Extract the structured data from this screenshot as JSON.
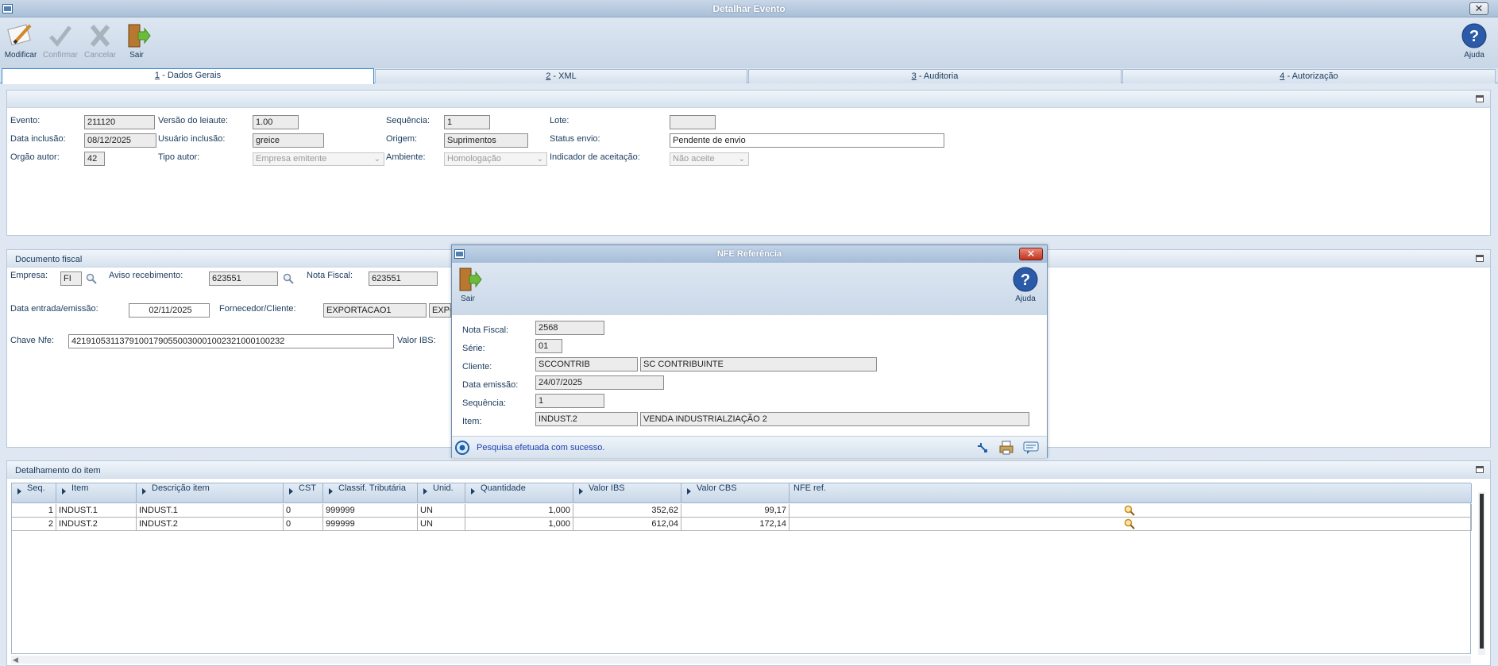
{
  "window": {
    "title": "Detalhar Evento",
    "close": "✕"
  },
  "toolbar": {
    "modificar": "Modificar",
    "confirmar": "Confirmar",
    "cancelar": "Cancelar",
    "sair": "Sair",
    "ajuda": "Ajuda"
  },
  "tabs": [
    {
      "key": "1",
      "label": " - Dados Gerais"
    },
    {
      "key": "2",
      "label": " - XML"
    },
    {
      "key": "3",
      "label": " - Auditoria"
    },
    {
      "key": "4",
      "label": " - Autorização"
    }
  ],
  "general": {
    "evento_label": "Evento:",
    "evento": "211120",
    "versao_label": "Versão do leiaute:",
    "versao": "1.00",
    "sequencia_label": "Sequência:",
    "sequencia": "1",
    "lote_label": "Lote:",
    "lote": "",
    "data_inclusao_label": "Data inclusão:",
    "data_inclusao": "08/12/2025",
    "usuario_label": "Usuário inclusão:",
    "usuario": "greice",
    "origem_label": "Origem:",
    "origem": "Suprimentos",
    "status_label": "Status envio:",
    "status": "Pendente de envio",
    "orgao_label": "Orgão autor:",
    "orgao": "42",
    "tipo_autor_label": "Tipo autor:",
    "tipo_autor": "Empresa emitente",
    "ambiente_label": "Ambiente:",
    "ambiente": "Homologação",
    "indicador_label": "Indicador de aceitação:",
    "indicador": "Não aceite"
  },
  "fiscal": {
    "title": "Documento fiscal",
    "empresa_label": "Empresa:",
    "empresa": "FI",
    "aviso_label": "Aviso recebimento:",
    "aviso": "623551",
    "nota_label": "Nota Fiscal:",
    "nota": "623551",
    "data_label": "Data entrada/emissão:",
    "data": "02/11/2025",
    "fornecedor_label": "Fornecedor/Cliente:",
    "fornecedor": "EXPORTACAO1",
    "fornecedor_nome": "EXPO",
    "chave_label": "Chave Nfe:",
    "chave": "42191053113791001790550030001002321000100232",
    "valor_ibs_label": "Valor IBS:"
  },
  "items": {
    "title": "Detalhamento do item",
    "columns": [
      "Seq.",
      "Item",
      "Descrição item",
      "CST",
      "Classif. Tributária",
      "Unid.",
      "Quantidade",
      "Valor IBS",
      "Valor CBS",
      "NFE ref."
    ],
    "rows": [
      {
        "seq": "1",
        "item": "INDUST.1",
        "descricao": "INDUST.1",
        "cst": "0",
        "classif": "999999",
        "unid": "UN",
        "quantidade": "1,000",
        "valor_ibs": "352,62",
        "valor_cbs": "99,17"
      },
      {
        "seq": "2",
        "item": "INDUST.2",
        "descricao": "INDUST.2",
        "cst": "0",
        "classif": "999999",
        "unid": "UN",
        "quantidade": "1,000",
        "valor_ibs": "612,04",
        "valor_cbs": "172,14"
      }
    ]
  },
  "dialog": {
    "title": "NFE Referência",
    "sair": "Sair",
    "ajuda": "Ajuda",
    "nota_label": "Nota Fiscal:",
    "nota": "2568",
    "serie_label": "Série:",
    "serie": "01",
    "cliente_label": "Cliente:",
    "cliente_codigo": "SCCONTRIB",
    "cliente_nome": "SC CONTRIBUINTE",
    "data_label": "Data emissão:",
    "data": "24/07/2025",
    "sequencia_label": "Sequência:",
    "sequencia": "1",
    "item_label": "Item:",
    "item_codigo": "INDUST.2",
    "item_nome": "VENDA INDUSTRIALZIAÇÃO 2",
    "status": "Pesquisa efetuada com sucesso."
  },
  "colors": {
    "accent": "#3a86d2",
    "label": "#1a3a5c",
    "status_text": "#1f3fb0"
  }
}
